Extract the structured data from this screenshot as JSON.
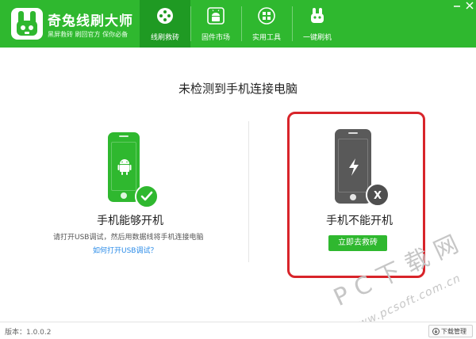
{
  "app": {
    "title": "奇兔线刷大师",
    "subtitle": "黑屏救砖  刷回官方  保你必备"
  },
  "nav": {
    "tabs": [
      {
        "label": "线刷救砖",
        "icon": "plus-circle-icon",
        "active": true
      },
      {
        "label": "固件市场",
        "icon": "android-icon",
        "active": false
      },
      {
        "label": "实用工具",
        "icon": "grid-icon",
        "active": false
      },
      {
        "label": "一键刷机",
        "icon": "rabbit-icon",
        "active": false
      }
    ]
  },
  "main": {
    "title": "未检测到手机连接电脑"
  },
  "left_card": {
    "title": "手机能够开机",
    "description": "请打开USB调试，然后用数据线将手机连接电脑",
    "link": "如何打开USB调试？",
    "phone_color": "#2fb82f",
    "badge": "check-icon"
  },
  "right_card": {
    "title": "手机不能开机",
    "button": "立即去救砖",
    "phone_color": "#555555",
    "badge": "x-icon",
    "badge_text": "X"
  },
  "watermark": {
    "big": "PC下载网",
    "small": "www.pcsoft.com.cn"
  },
  "footer": {
    "version": "版本：1.0.0.2",
    "download_manager": "下载管理"
  },
  "colors": {
    "brand_green": "#2fb82f",
    "active_tab": "#1f9a23",
    "highlight_red": "#d8242a",
    "link_blue": "#2a8be8"
  }
}
